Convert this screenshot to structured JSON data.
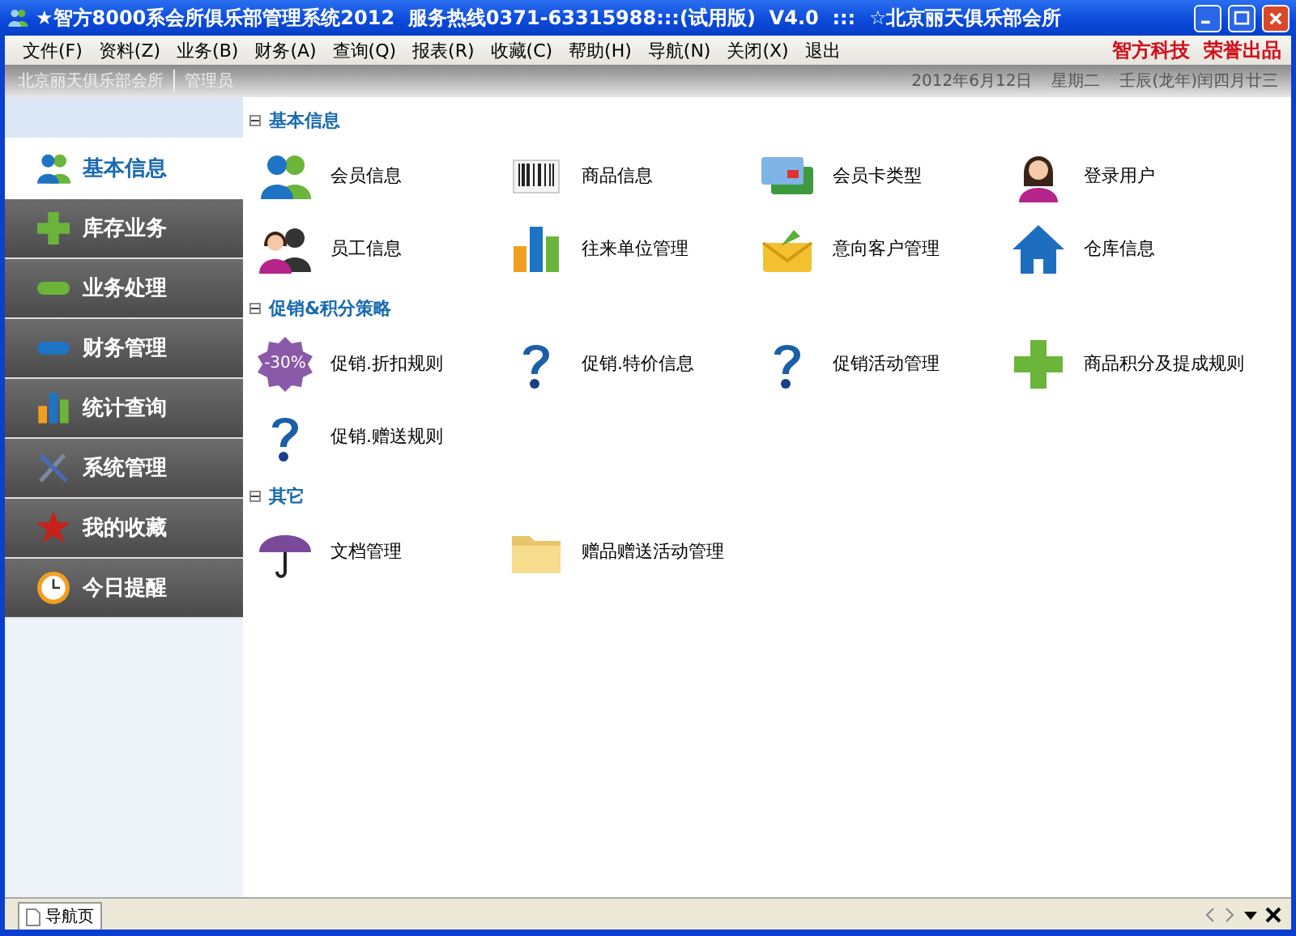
{
  "window": {
    "title": "★智方8000系会所俱乐部管理系统2012  服务热线0371-63315988:::(试用版)  V4.0  :::  ☆北京丽天俱乐部会所"
  },
  "menu": [
    "文件(F)",
    "资料(Z)",
    "业务(B)",
    "财务(A)",
    "查询(Q)",
    "报表(R)",
    "收藏(C)",
    "帮助(H)",
    "导航(N)",
    "关闭(X)",
    "退出"
  ],
  "brand": "智方科技  荣誉出品",
  "header": {
    "club": "北京丽天俱乐部会所",
    "role": "管理员",
    "date": "2012年6月12日",
    "weekday": "星期二",
    "lunar": "壬辰(龙年)闰四月廿三"
  },
  "sidebar": {
    "items": [
      {
        "label": "基本信息",
        "selected": true
      },
      {
        "label": "库存业务",
        "selected": false
      },
      {
        "label": "业务处理",
        "selected": false
      },
      {
        "label": "财务管理",
        "selected": false
      },
      {
        "label": "统计查询",
        "selected": false
      },
      {
        "label": "系统管理",
        "selected": false
      },
      {
        "label": "我的收藏",
        "selected": false
      },
      {
        "label": "今日提醒",
        "selected": false
      }
    ]
  },
  "sections": [
    {
      "title": "基本信息",
      "expanded": true,
      "items": [
        {
          "label": "会员信息"
        },
        {
          "label": "商品信息"
        },
        {
          "label": "会员卡类型"
        },
        {
          "label": "登录用户"
        },
        {
          "label": "员工信息"
        },
        {
          "label": "往来单位管理"
        },
        {
          "label": "意向客户管理"
        },
        {
          "label": "仓库信息"
        }
      ]
    },
    {
      "title": "促销&积分策略",
      "expanded": true,
      "items": [
        {
          "label": "促销.折扣规则",
          "badge": "-30%"
        },
        {
          "label": "促销.特价信息"
        },
        {
          "label": "促销活动管理"
        },
        {
          "label": "商品积分及提成规则"
        },
        {
          "label": "促销.赠送规则"
        }
      ]
    },
    {
      "title": "其它",
      "expanded": true,
      "items": [
        {
          "label": "文档管理"
        },
        {
          "label": "赠品赠送活动管理"
        }
      ]
    }
  ],
  "tabs": [
    {
      "label": "导航页",
      "selected": true
    }
  ]
}
